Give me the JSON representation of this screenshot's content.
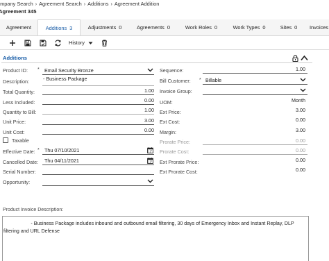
{
  "breadcrumb": {
    "items": [
      "ompany Search",
      "Agreement Search",
      "Additions",
      "Agreement Addition"
    ]
  },
  "page_title": "Agreement 345",
  "tabs": [
    {
      "label": "Agreement",
      "count": ""
    },
    {
      "label": "Additions",
      "count": "3"
    },
    {
      "label": "Adjustments",
      "count": "0"
    },
    {
      "label": "Agreements",
      "count": "0"
    },
    {
      "label": "Work Roles",
      "count": "0"
    },
    {
      "label": "Work Types",
      "count": "0"
    },
    {
      "label": "Sites",
      "count": "0"
    },
    {
      "label": "Invoices",
      "count": ""
    }
  ],
  "toolbar": {
    "history_label": "History",
    "icons": [
      "plus-icon",
      "save-icon",
      "save-and-close-icon",
      "refresh-icon",
      "trash-icon"
    ]
  },
  "section": {
    "title": "Additions"
  },
  "left_fields": {
    "product_id": {
      "label": "Product ID:",
      "value": "Email Security Bronze"
    },
    "description": {
      "label": "Description:",
      "value": "- Business Package"
    },
    "total_quantity": {
      "label": "Total Quantity:",
      "value": "1.00"
    },
    "less_included": {
      "label": "Less Included:",
      "value": "0.00"
    },
    "quantity_to_bill": {
      "label": "Quantity to Bill:",
      "value": "1.00"
    },
    "unit_price": {
      "label": "Unit Price:",
      "value": "3.00"
    },
    "unit_cost": {
      "label": "Unit Cost:",
      "value": "0.00"
    },
    "taxable": {
      "label": "Taxable",
      "checked": false
    },
    "effective_date": {
      "label": "Effective Date:",
      "value": "Thu 07/10/2021"
    },
    "cancelled_date": {
      "label": "Cancelled Date:",
      "value": "Thu 04/11/2021"
    },
    "serial_number": {
      "label": "Serial Number:",
      "value": ""
    },
    "opportunity": {
      "label": "Opportunity:",
      "value": ""
    }
  },
  "right_fields": {
    "sequence": {
      "label": "Sequence:",
      "value": "1.00"
    },
    "bill_customer": {
      "label": "Bill Customer:",
      "value": "Billable"
    },
    "invoice_group": {
      "label": "Invoice Group:",
      "value": ""
    },
    "uom": {
      "label": "UOM:",
      "value": "Month"
    },
    "ext_price": {
      "label": "Ext Price:",
      "value": "3.00"
    },
    "ext_cost": {
      "label": "Ext Cost:",
      "value": "0.00"
    },
    "margin": {
      "label": "Margin:",
      "value": "3.00"
    },
    "prorate_price": {
      "label": "Prorate Price:",
      "value": "0.00"
    },
    "prorate_cost": {
      "label": "Prorate Cost:",
      "value": "0.00"
    },
    "ext_prorate_price": {
      "label": "Ext Prorate Price:",
      "value": "0.00"
    },
    "ext_prorate_cost": {
      "label": "Ext Prorate Cost:",
      "value": "0.00"
    }
  },
  "product_invoice_description": {
    "label": "Product Invoice Description:",
    "value": "                    - Business Package includes inbound and outbound email filtering, 30 days of Emergency Inbox and Instant Replay, DLP filtering and URL Defense"
  },
  "colors": {
    "accent": "#1a5ea8",
    "tab_bar": "#f5f5f5"
  }
}
